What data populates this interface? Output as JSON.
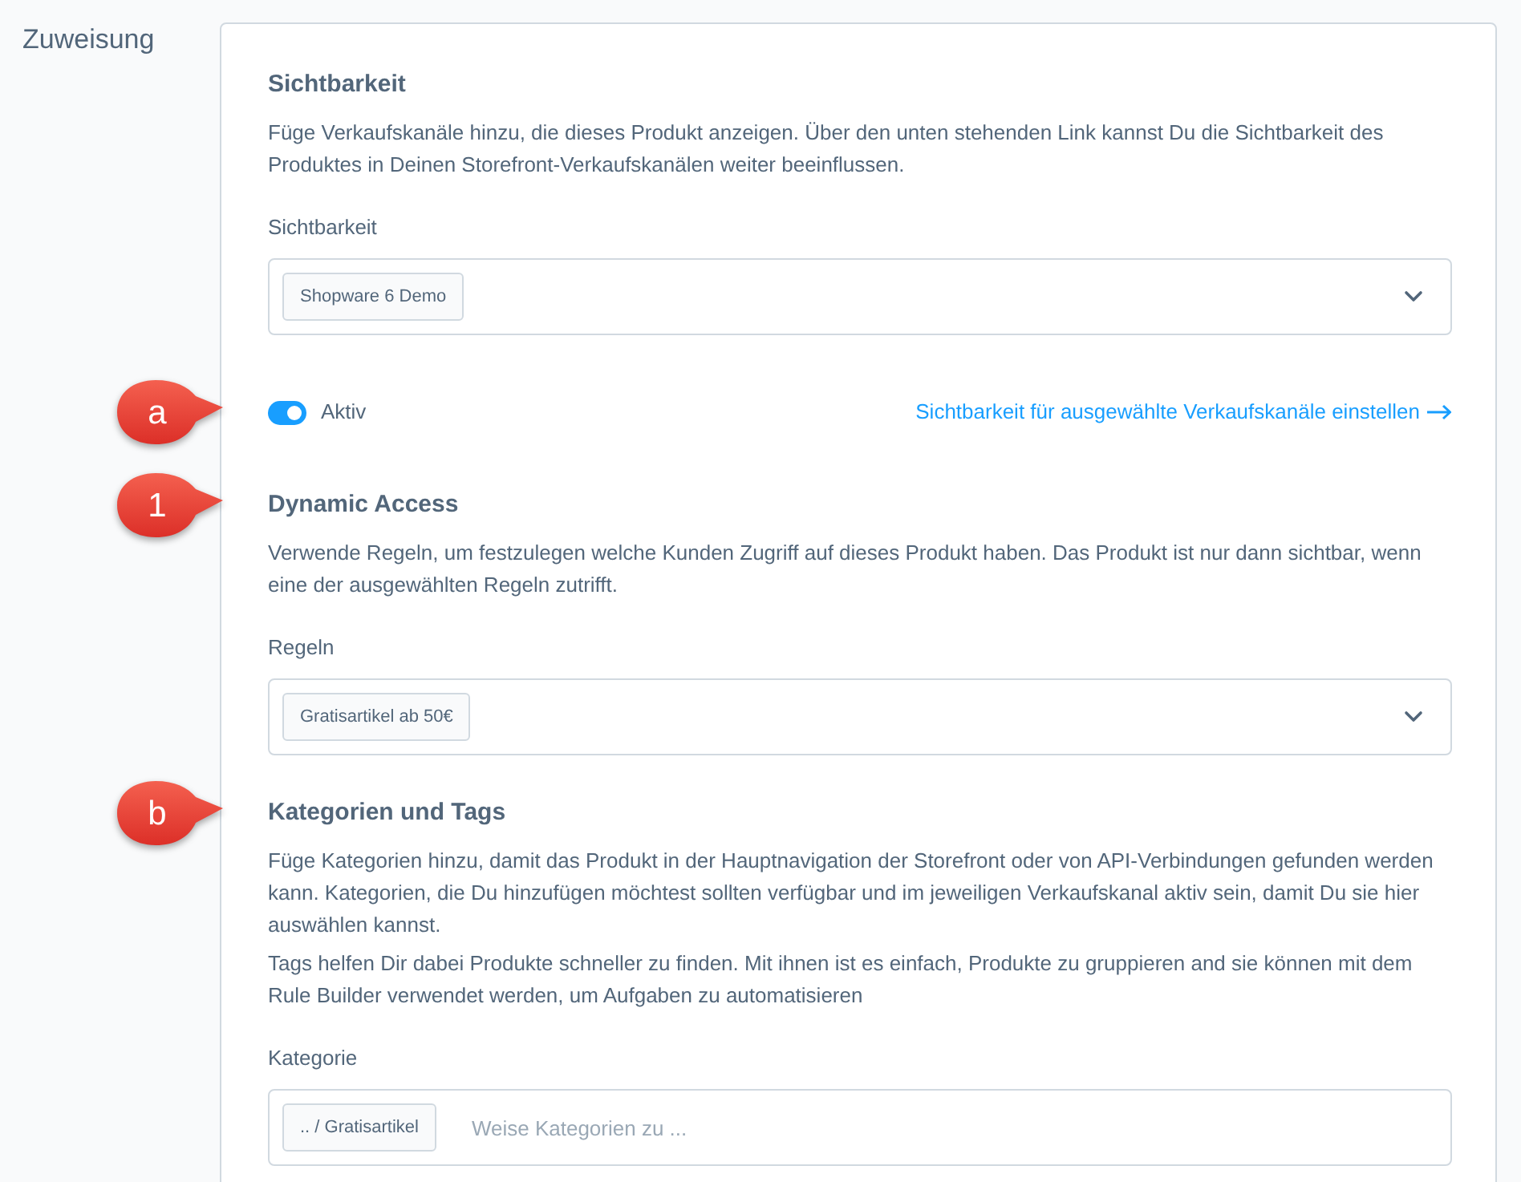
{
  "page": {
    "label": "Zuweisung"
  },
  "sections": [
    {
      "title": "Sichtbarkeit",
      "paragraphs": [
        "Füge Verkaufskanäle hinzu, die dieses Produkt anzeigen. Über den unten stehenden Link kannst Du die Sichtbarkeit des Produktes in Deinen Storefront-Verkaufskanälen weiter beeinflussen."
      ],
      "field": {
        "label": "Sichtbarkeit",
        "kind": "select",
        "tags": [
          "Shopware 6 Demo"
        ]
      },
      "toggle": {
        "label": "Aktiv",
        "on": true,
        "callout": "a"
      },
      "link": "Sichtbarkeit für ausgewählte Verkaufskanäle einstellen"
    },
    {
      "title": "Dynamic Access",
      "callout": "1",
      "paragraphs": [
        "Verwende Regeln, um festzulegen welche Kunden Zugriff auf dieses Produkt haben. Das Produkt ist nur dann sichtbar, wenn eine der ausgewählten Regeln zutrifft."
      ],
      "field": {
        "label": "Regeln",
        "kind": "select",
        "tags": [
          "Gratisartikel ab 50€"
        ]
      }
    },
    {
      "title": "Kategorien und Tags",
      "callout": "b",
      "paragraphs": [
        "Füge Kategorien hinzu, damit das Produkt in der Hauptnavigation der Storefront oder von API-Verbindungen gefunden werden kann. Kategorien, die Du hinzufügen möchtest sollten verfügbar und im jeweiligen Verkaufskanal aktiv sein, damit Du sie hier auswählen kannst.",
        "Tags helfen Dir dabei Produkte schneller zu finden. Mit ihnen ist es einfach, Produkte zu gruppieren and sie können mit dem Rule Builder verwendet werden, um Aufgaben zu automatisieren"
      ],
      "field": {
        "label": "Kategorie",
        "kind": "input",
        "tags": [
          ".. / Gratisartikel"
        ],
        "placeholder": "Weise Kategorien zu ..."
      }
    }
  ]
}
